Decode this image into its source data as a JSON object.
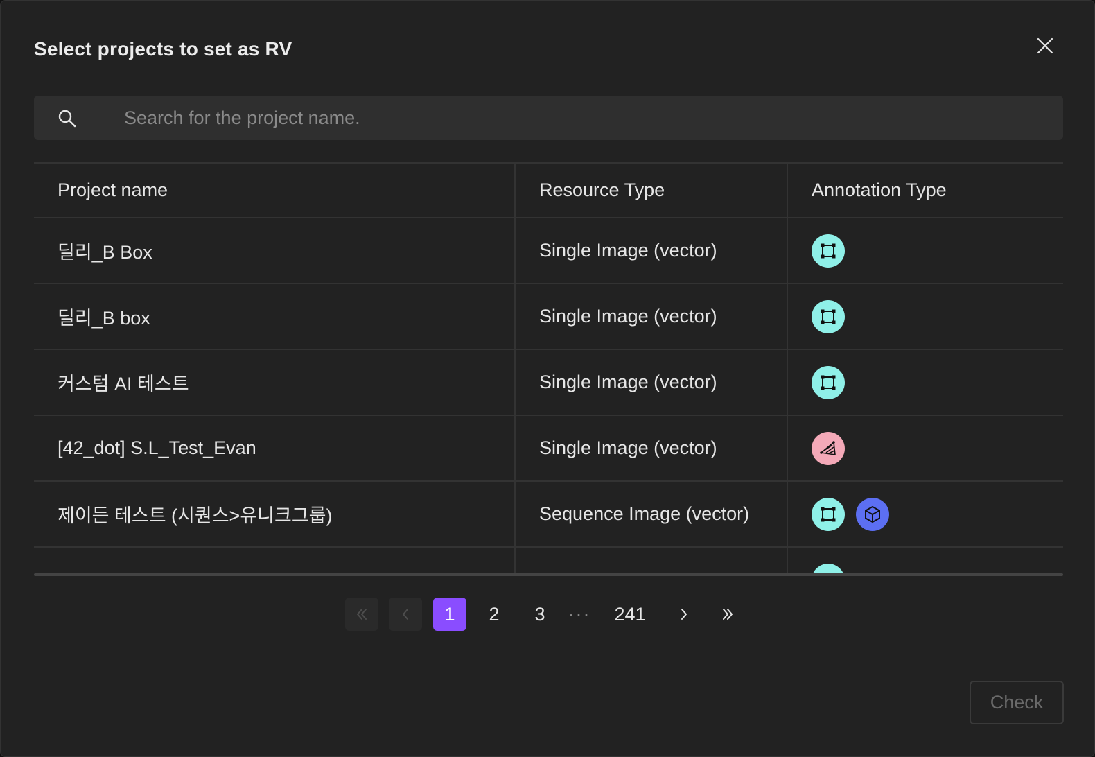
{
  "dialog": {
    "title": "Select projects to set as RV",
    "close_icon": "close-icon"
  },
  "search": {
    "placeholder": "Search for the project name.",
    "value": "",
    "icon": "search-icon"
  },
  "table": {
    "headers": [
      "Project name",
      "Resource Type",
      "Annotation Type"
    ],
    "rows": [
      {
        "name": "딜리_B Box",
        "resource": "Single Image (vector)",
        "annotations": [
          "box"
        ]
      },
      {
        "name": "딜리_B box",
        "resource": "Single Image (vector)",
        "annotations": [
          "box"
        ]
      },
      {
        "name": "커스텀 AI 테스트",
        "resource": "Single Image (vector)",
        "annotations": [
          "box"
        ]
      },
      {
        "name": "[42_dot] S.L_Test_Evan",
        "resource": "Single Image (vector)",
        "annotations": [
          "polyline"
        ]
      },
      {
        "name": "제이든 테스트 (시퀀스>유니크그룹)",
        "resource": "Sequence Image (vector)",
        "annotations": [
          "box",
          "cuboid"
        ]
      },
      {
        "name": "",
        "resource": "",
        "annotations": [
          "box"
        ]
      }
    ]
  },
  "annotation_icons": {
    "box": {
      "icon": "bounding-box-icon",
      "color": "#8ff0e8"
    },
    "polyline": {
      "icon": "polyline-icon",
      "color": "#f4a9b8"
    },
    "cuboid": {
      "icon": "cuboid-icon",
      "color": "#5c6ff2"
    }
  },
  "pagination": {
    "first_icon": "double-chevron-left-icon",
    "prev_icon": "chevron-left-icon",
    "pages": [
      "1",
      "2",
      "3"
    ],
    "ellipsis": "···",
    "last_page": "241",
    "current": "1",
    "next_icon": "chevron-right-icon",
    "last_icon": "double-chevron-right-icon"
  },
  "footer": {
    "check_label": "Check"
  },
  "colors": {
    "accent": "#8a4dff",
    "background": "#222222"
  }
}
